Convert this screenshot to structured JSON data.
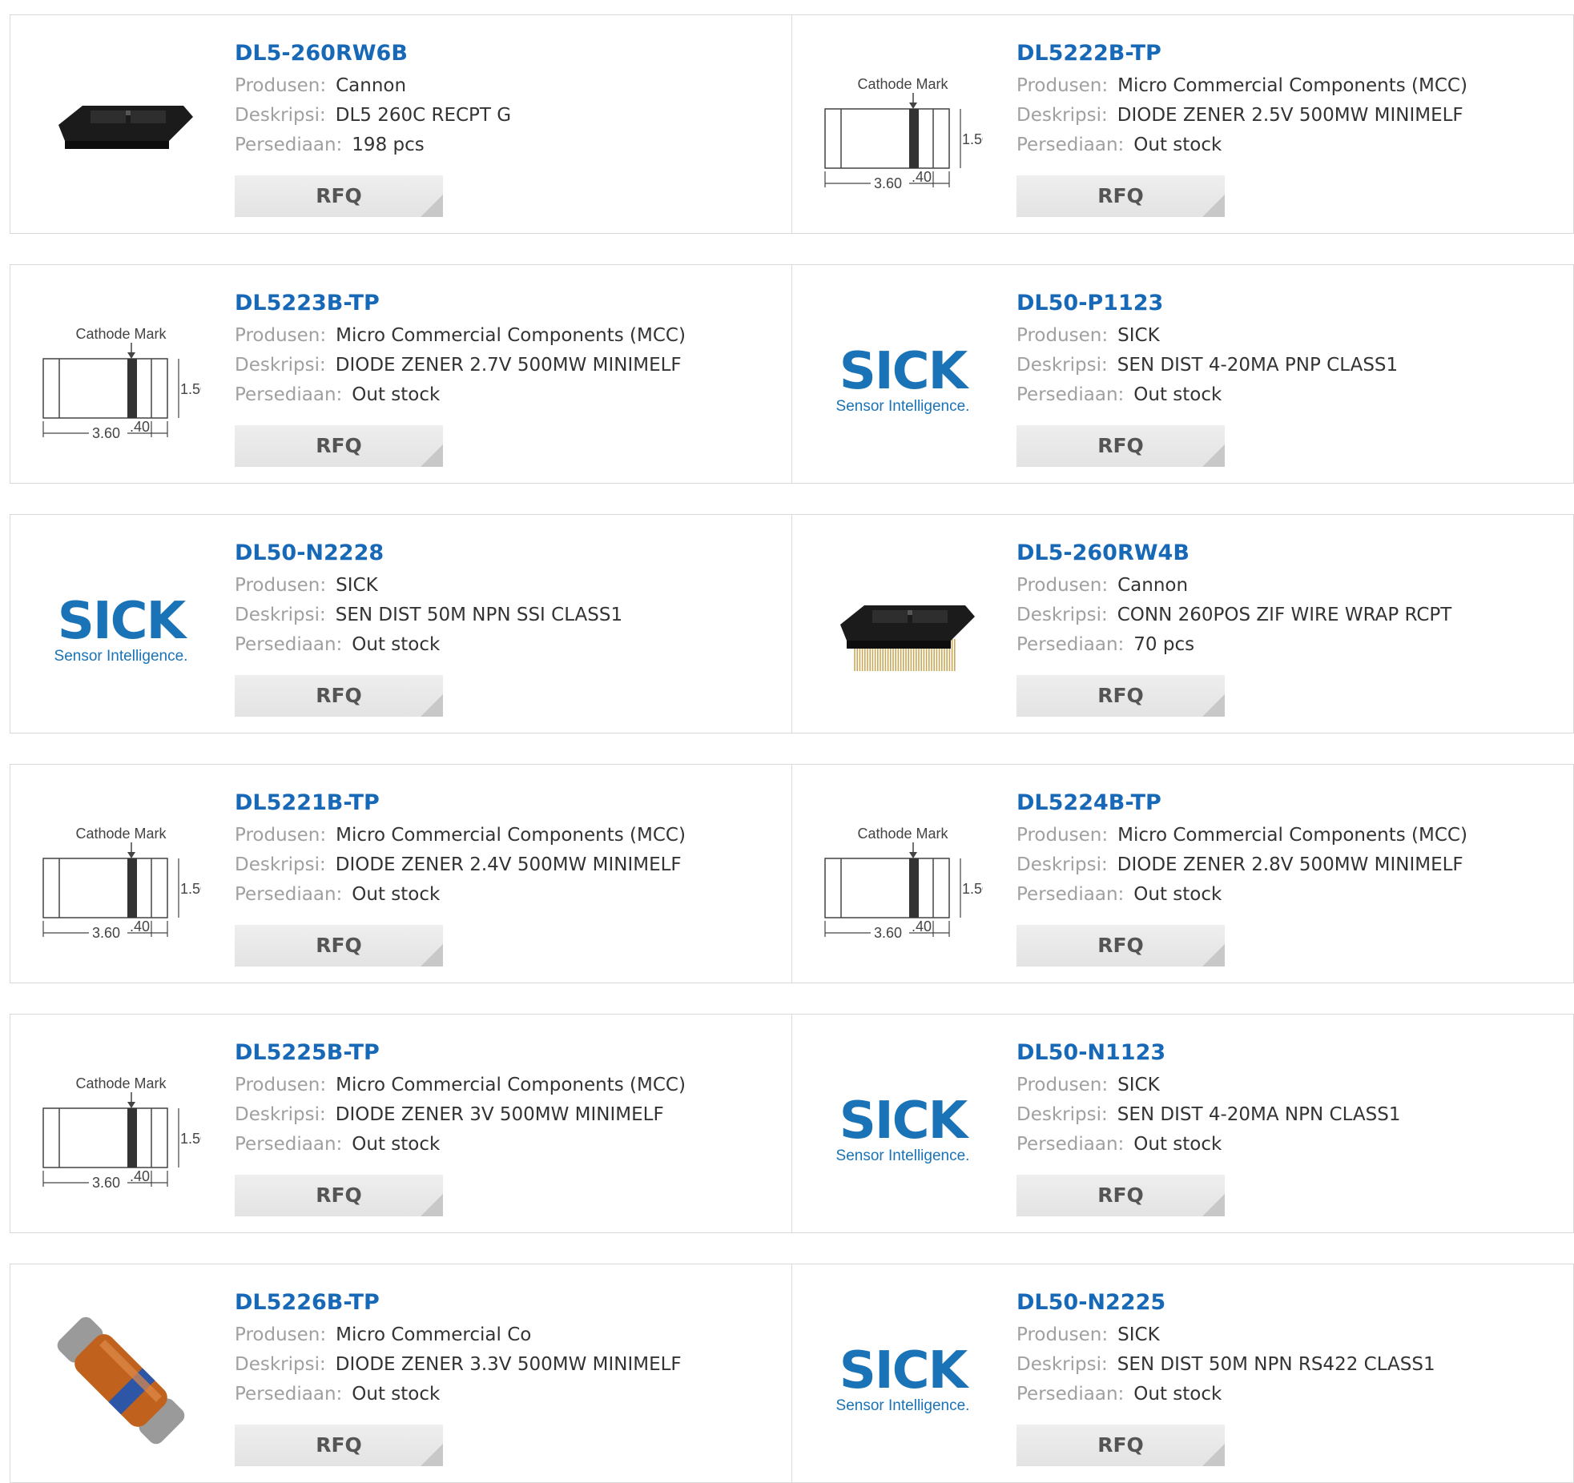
{
  "labels": {
    "manufacturer": "Produsen:",
    "description": "Deskripsi:",
    "stock": "Persediaan:",
    "rfq": "RFQ"
  },
  "diagram_text": {
    "cathode": "Cathode Mark",
    "height": "1.50",
    "length": "3.60",
    "band": ".40"
  },
  "logo_text": {
    "sick": "SICK",
    "tagline": "Sensor Intelligence."
  },
  "colors": {
    "title": "#1769b8",
    "label": "#a0a0a0",
    "value": "#333333",
    "sick_blue": "#1a73b7"
  },
  "products": [
    {
      "part": "DL5-260RW6B",
      "manufacturer": "Cannon",
      "description": "DL5 260C RECPT G",
      "stock": "198 pcs",
      "image": "connector"
    },
    {
      "part": "DL5222B-TP",
      "manufacturer": "Micro Commercial Components (MCC)",
      "description": "DIODE ZENER 2.5V 500MW MINIMELF",
      "stock": "Out stock",
      "image": "diagram"
    },
    {
      "part": "DL5223B-TP",
      "manufacturer": "Micro Commercial Components (MCC)",
      "description": "DIODE ZENER 2.7V 500MW MINIMELF",
      "stock": "Out stock",
      "image": "diagram"
    },
    {
      "part": "DL50-P1123",
      "manufacturer": "SICK",
      "description": "SEN DIST 4-20MA PNP CLASS1",
      "stock": "Out stock",
      "image": "sick"
    },
    {
      "part": "DL50-N2228",
      "manufacturer": "SICK",
      "description": "SEN DIST 50M NPN SSI CLASS1",
      "stock": "Out stock",
      "image": "sick"
    },
    {
      "part": "DL5-260RW4B",
      "manufacturer": "Cannon",
      "description": "CONN 260POS ZIF WIRE WRAP RCPT",
      "stock": "70 pcs",
      "image": "connector-pins"
    },
    {
      "part": "DL5221B-TP",
      "manufacturer": "Micro Commercial Components (MCC)",
      "description": "DIODE ZENER 2.4V 500MW MINIMELF",
      "stock": "Out stock",
      "image": "diagram"
    },
    {
      "part": "DL5224B-TP",
      "manufacturer": "Micro Commercial Components (MCC)",
      "description": "DIODE ZENER 2.8V 500MW MINIMELF",
      "stock": "Out stock",
      "image": "diagram"
    },
    {
      "part": "DL5225B-TP",
      "manufacturer": "Micro Commercial Components (MCC)",
      "description": "DIODE ZENER 3V 500MW MINIMELF",
      "stock": "Out stock",
      "image": "diagram"
    },
    {
      "part": "DL50-N1123",
      "manufacturer": "SICK",
      "description": "SEN DIST 4-20MA NPN CLASS1",
      "stock": "Out stock",
      "image": "sick"
    },
    {
      "part": "DL5226B-TP",
      "manufacturer": "Micro Commercial Co",
      "description": "DIODE ZENER 3.3V 500MW MINIMELF",
      "stock": "Out stock",
      "image": "melf"
    },
    {
      "part": "DL50-N2225",
      "manufacturer": "SICK",
      "description": "SEN DIST 50M NPN RS422 CLASS1",
      "stock": "Out stock",
      "image": "sick"
    }
  ]
}
